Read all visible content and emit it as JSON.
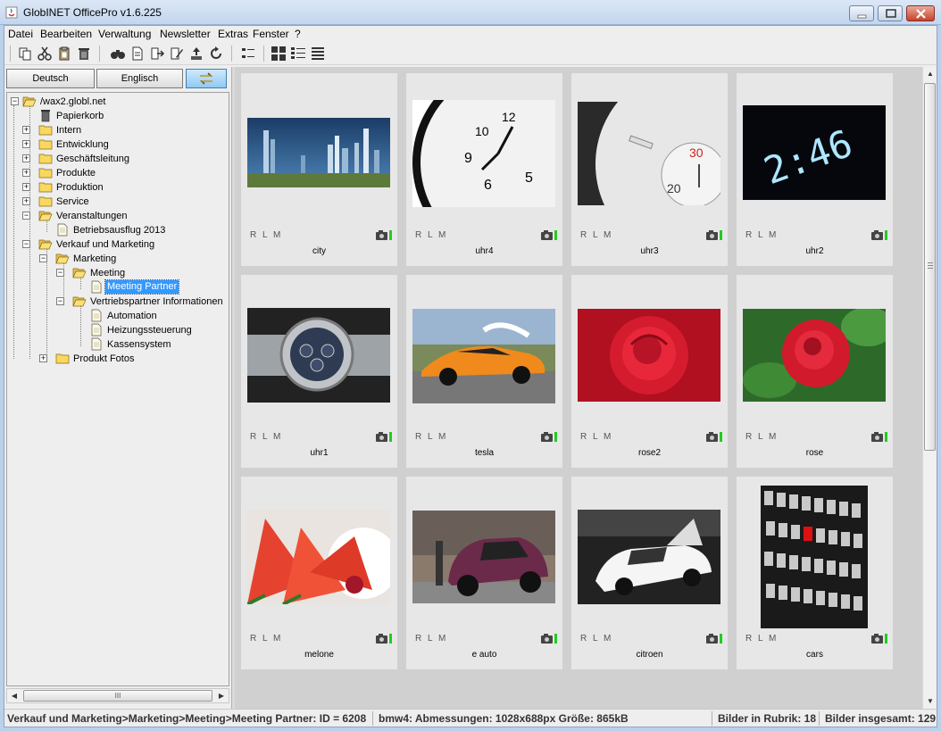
{
  "window": {
    "title": "GlobINET OfficePro v1.6.225"
  },
  "menu": [
    "Datei",
    "Bearbeiten",
    "Verwaltung",
    "Newsletter",
    "Extras",
    "Fenster",
    "?"
  ],
  "toolbar": {
    "buttons": [
      "copy-icon",
      "cut-icon",
      "paste-icon",
      "delete-icon",
      "binoculars-icon",
      "new-document-icon",
      "forward-icon",
      "edit-icon",
      "upload-icon",
      "refresh-icon",
      "tree-view-icon",
      "grid-view-icon",
      "detail-list-icon",
      "list-view-icon"
    ]
  },
  "language": {
    "german": "Deutsch",
    "english": "Englisch",
    "swap_icon": "swap-icon"
  },
  "tree": {
    "root": "/wax2.globl.net",
    "nodes": [
      {
        "label": "Papierkorb",
        "icon": "trash-icon"
      },
      {
        "label": "Intern",
        "icon": "folder-icon"
      },
      {
        "label": "Entwicklung",
        "icon": "folder-icon"
      },
      {
        "label": "Geschäftsleitung",
        "icon": "folder-icon"
      },
      {
        "label": "Produkte",
        "icon": "folder-icon"
      },
      {
        "label": "Produktion",
        "icon": "folder-icon"
      },
      {
        "label": "Service",
        "icon": "folder-icon"
      },
      {
        "label": "Veranstaltungen",
        "icon": "folder-open-icon"
      },
      {
        "label": "Betriebsausflug 2013",
        "icon": "document-icon"
      },
      {
        "label": "Verkauf und Marketing",
        "icon": "folder-open-icon"
      },
      {
        "label": "Marketing",
        "icon": "folder-open-icon"
      },
      {
        "label": "Meeting",
        "icon": "folder-open-icon"
      },
      {
        "label": "Meeting Partner",
        "icon": "document-icon",
        "selected": true
      },
      {
        "label": "Vertriebspartner Informationen",
        "icon": "folder-open-icon"
      },
      {
        "label": "Automation",
        "icon": "document-icon"
      },
      {
        "label": "Heizungssteuerung",
        "icon": "document-icon"
      },
      {
        "label": "Kassensystem",
        "icon": "document-icon"
      },
      {
        "label": "Produkt Fotos",
        "icon": "folder-icon"
      }
    ],
    "scroll_grip": "III"
  },
  "gallery": {
    "rlm": "R L M",
    "items": [
      {
        "name": "city",
        "image": "city-skyline-image"
      },
      {
        "name": "uhr4",
        "image": "clock-image"
      },
      {
        "name": "uhr3",
        "image": "clock-closeup-image"
      },
      {
        "name": "uhr2",
        "image": "digital-clock-image"
      },
      {
        "name": "uhr1",
        "image": "wristwatch-image"
      },
      {
        "name": "tesla",
        "image": "orange-car-image"
      },
      {
        "name": "rose2",
        "image": "red-rose-image"
      },
      {
        "name": "rose",
        "image": "red-rose-leaves-image"
      },
      {
        "name": "melone",
        "image": "watermelon-image"
      },
      {
        "name": "e auto",
        "image": "electric-car-image"
      },
      {
        "name": "citroen",
        "image": "concept-car-image"
      },
      {
        "name": "cars",
        "image": "parking-lot-image"
      }
    ]
  },
  "status": {
    "path": "Verkauf und Marketing>Marketing>Meeting>Meeting Partner: ID = 6208",
    "image_info": "bmw4: Abmessungen: 1028x688px Größe: 865kB",
    "rubric_count": "Bilder in Rubrik: 18",
    "total_count": "Bilder insgesamt: 129"
  },
  "colors": {
    "selection": "#3399ff",
    "swap_button": "#8fcaf3",
    "status_green": "#22cc22"
  }
}
